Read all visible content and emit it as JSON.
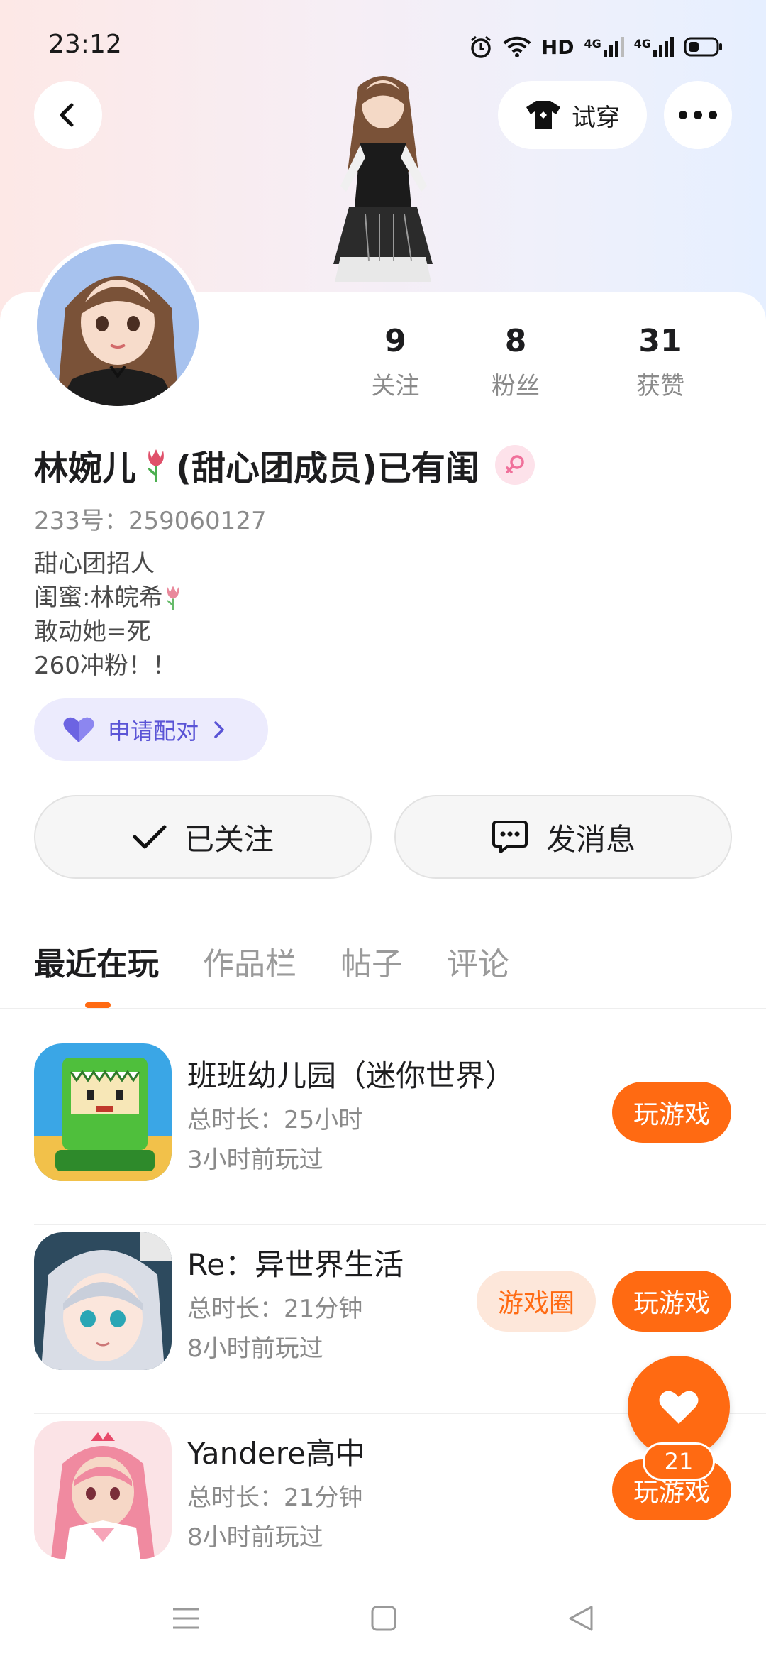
{
  "status_bar": {
    "time": "23:12",
    "network_label": "HD",
    "network_label_2": "4G",
    "icons": [
      "alarm-icon",
      "wifi-icon",
      "hd-icon",
      "signal-4g-icon",
      "signal-4g-icon",
      "battery-icon"
    ]
  },
  "header": {
    "try_on_label": "试穿",
    "icons": {
      "back": "back-icon",
      "try_on": "tshirt-icon",
      "more": "more-icon"
    }
  },
  "profile": {
    "stats": [
      {
        "value": "9",
        "label": "关注"
      },
      {
        "value": "8",
        "label": "粉丝"
      },
      {
        "value": "31",
        "label": "获赞"
      }
    ],
    "name_part1": "林婉儿",
    "name_part2": "(甜心团成员)已有闺",
    "id_text": "233号：259060127",
    "bio_lines": [
      "甜心团招人",
      "闺蜜:林皖希",
      "敢动她=死",
      "260冲粉！！"
    ],
    "match_label": "申请配对"
  },
  "actions": {
    "follow_label": "已关注",
    "message_label": "发消息"
  },
  "tabs": [
    "最近在玩",
    "作品栏",
    "帖子",
    "评论"
  ],
  "games": [
    {
      "name": "班班幼儿园（迷你世界）",
      "duration": "总时长：25小时",
      "last_played": "3小时前玩过",
      "play_label": "玩游戏"
    },
    {
      "name": "Re：异世界生活",
      "duration": "总时长：21分钟",
      "last_played": "8小时前玩过",
      "play_label": "玩游戏",
      "circle_label": "游戏圈"
    },
    {
      "name": "Yandere高中",
      "duration": "总时长：21分钟",
      "last_played": "8小时前玩过",
      "play_label": "玩游戏"
    }
  ],
  "fab": {
    "count": "21"
  },
  "colors": {
    "accent": "#ff6a12",
    "match_purple": "#5a54d6"
  }
}
